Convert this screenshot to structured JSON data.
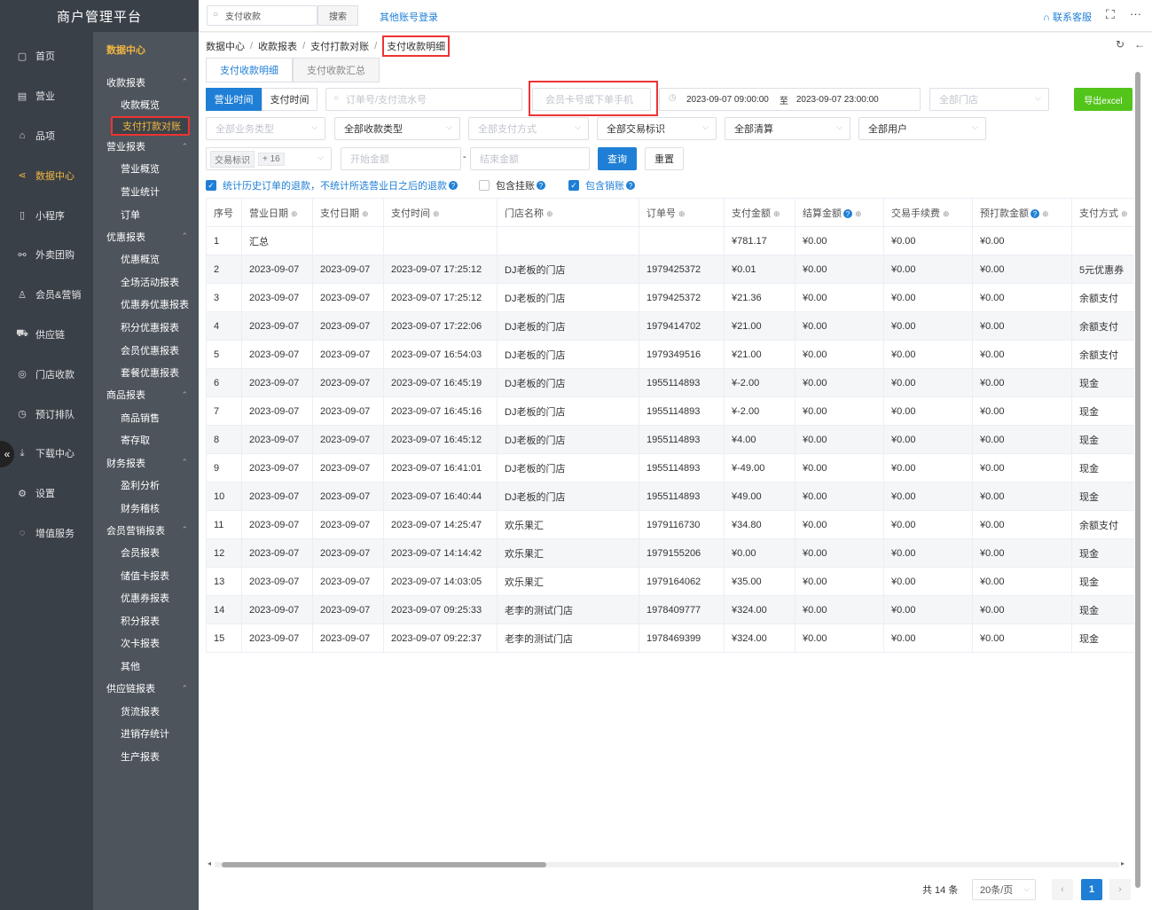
{
  "app": {
    "brand": "商户管理平台"
  },
  "nav": [
    {
      "icon": "home-icon",
      "glyph": "▢",
      "label": "首页"
    },
    {
      "icon": "business-icon",
      "glyph": "▤",
      "label": "营业"
    },
    {
      "icon": "product-icon",
      "glyph": "⌂",
      "label": "品项"
    },
    {
      "icon": "data-center-icon",
      "glyph": "⋖",
      "label": "数据中心",
      "active": true
    },
    {
      "icon": "mini-program-icon",
      "glyph": "▯",
      "label": "小程序"
    },
    {
      "icon": "group-buy-icon",
      "glyph": "⚯",
      "label": "外卖团购"
    },
    {
      "icon": "member-icon",
      "glyph": "♙",
      "label": "会员&营销"
    },
    {
      "icon": "supply-chain-icon",
      "glyph": "⛟",
      "label": "供应链"
    },
    {
      "icon": "store-cashier-icon",
      "glyph": "◎",
      "label": "门店收款"
    },
    {
      "icon": "reservation-icon",
      "glyph": "◷",
      "label": "预订排队"
    },
    {
      "icon": "download-icon",
      "glyph": "⤓",
      "label": "下载中心"
    },
    {
      "icon": "settings-icon",
      "glyph": "⚙",
      "label": "设置"
    },
    {
      "icon": "value-added-icon",
      "glyph": "◌",
      "label": "增值服务"
    }
  ],
  "section_title": "数据中心",
  "groups": [
    {
      "title": "收款报表",
      "items": [
        "收款概览",
        "支付打款对账"
      ]
    },
    {
      "title": "营业报表",
      "items": [
        "营业概览",
        "营业统计",
        "订单"
      ]
    },
    {
      "title": "优惠报表",
      "items": [
        "优惠概览",
        "全场活动报表",
        "优惠券优惠报表",
        "积分优惠报表",
        "会员优惠报表",
        "套餐优惠报表"
      ]
    },
    {
      "title": "商品报表",
      "items": [
        "商品销售",
        "寄存取"
      ]
    },
    {
      "title": "财务报表",
      "items": [
        "盈利分析",
        "财务稽核"
      ]
    },
    {
      "title": "会员营销报表",
      "items": [
        "会员报表",
        "储值卡报表",
        "优惠券报表",
        "积分报表",
        "次卡报表",
        "其他"
      ]
    },
    {
      "title": "供应链报表",
      "items": [
        "货流报表",
        "进销存统计",
        "生产报表"
      ]
    }
  ],
  "selected_item": "支付打款对账",
  "topbar": {
    "search_value": "支付收款",
    "search_button": "搜索",
    "other_login": "其他账号登录",
    "contact": "联系客服"
  },
  "breadcrumb": [
    "数据中心",
    "收款报表",
    "支付打款对账",
    "支付收款明细"
  ],
  "tabs": [
    "支付收款明细",
    "支付收款汇总"
  ],
  "time_mode": [
    "营业时间",
    "支付时间"
  ],
  "filters": {
    "order_placeholder": "订单号/支付流水号",
    "member_placeholder": "会员卡号或下单手机",
    "date_from": "2023-09-07 09:00:00",
    "date_sep": "至",
    "date_to": "2023-09-07 23:00:00",
    "store": "全部门店",
    "export": "导出excel",
    "biz_type": "全部业务类型",
    "receipt_type": "全部收款类型",
    "pay_method": "全部支付方式",
    "trade_flag": "全部交易标识",
    "clearing": "全部清算",
    "users": "全部用户",
    "tag": "交易标识",
    "tag_more": "+ 16",
    "amount_min": "开始金额",
    "amount_dash": "-",
    "amount_max": "结束金额",
    "query": "查询",
    "reset": "重置"
  },
  "checks": [
    {
      "label": "统计历史订单的退款，不统计所选营业日之后的退款",
      "checked": true,
      "highlight": true
    },
    {
      "label": "包含挂账",
      "checked": false,
      "highlight": false
    },
    {
      "label": "包含销账",
      "checked": true,
      "highlight": true
    }
  ],
  "table": {
    "headers": [
      "序号",
      "营业日期",
      "支付日期",
      "支付时间",
      "门店名称",
      "订单号",
      "支付金额",
      "结算金额",
      "交易手续费",
      "预打款金额",
      "支付方式"
    ],
    "rows": [
      [
        "1",
        "汇总",
        "",
        "",
        "",
        "",
        "¥781.17",
        "¥0.00",
        "¥0.00",
        "¥0.00",
        ""
      ],
      [
        "2",
        "2023-09-07",
        "2023-09-07",
        "2023-09-07 17:25:12",
        "DJ老板的门店",
        "1979425372",
        "¥0.01",
        "¥0.00",
        "¥0.00",
        "¥0.00",
        "5元优惠券"
      ],
      [
        "3",
        "2023-09-07",
        "2023-09-07",
        "2023-09-07 17:25:12",
        "DJ老板的门店",
        "1979425372",
        "¥21.36",
        "¥0.00",
        "¥0.00",
        "¥0.00",
        "余额支付"
      ],
      [
        "4",
        "2023-09-07",
        "2023-09-07",
        "2023-09-07 17:22:06",
        "DJ老板的门店",
        "1979414702",
        "¥21.00",
        "¥0.00",
        "¥0.00",
        "¥0.00",
        "余额支付"
      ],
      [
        "5",
        "2023-09-07",
        "2023-09-07",
        "2023-09-07 16:54:03",
        "DJ老板的门店",
        "1979349516",
        "¥21.00",
        "¥0.00",
        "¥0.00",
        "¥0.00",
        "余额支付"
      ],
      [
        "6",
        "2023-09-07",
        "2023-09-07",
        "2023-09-07 16:45:19",
        "DJ老板的门店",
        "1955114893",
        "¥-2.00",
        "¥0.00",
        "¥0.00",
        "¥0.00",
        "现金"
      ],
      [
        "7",
        "2023-09-07",
        "2023-09-07",
        "2023-09-07 16:45:16",
        "DJ老板的门店",
        "1955114893",
        "¥-2.00",
        "¥0.00",
        "¥0.00",
        "¥0.00",
        "现金"
      ],
      [
        "8",
        "2023-09-07",
        "2023-09-07",
        "2023-09-07 16:45:12",
        "DJ老板的门店",
        "1955114893",
        "¥4.00",
        "¥0.00",
        "¥0.00",
        "¥0.00",
        "现金"
      ],
      [
        "9",
        "2023-09-07",
        "2023-09-07",
        "2023-09-07 16:41:01",
        "DJ老板的门店",
        "1955114893",
        "¥-49.00",
        "¥0.00",
        "¥0.00",
        "¥0.00",
        "现金"
      ],
      [
        "10",
        "2023-09-07",
        "2023-09-07",
        "2023-09-07 16:40:44",
        "DJ老板的门店",
        "1955114893",
        "¥49.00",
        "¥0.00",
        "¥0.00",
        "¥0.00",
        "现金"
      ],
      [
        "11",
        "2023-09-07",
        "2023-09-07",
        "2023-09-07 14:25:47",
        "欢乐果汇",
        "1979116730",
        "¥34.80",
        "¥0.00",
        "¥0.00",
        "¥0.00",
        "余额支付"
      ],
      [
        "12",
        "2023-09-07",
        "2023-09-07",
        "2023-09-07 14:14:42",
        "欢乐果汇",
        "1979155206",
        "¥0.00",
        "¥0.00",
        "¥0.00",
        "¥0.00",
        "现金"
      ],
      [
        "13",
        "2023-09-07",
        "2023-09-07",
        "2023-09-07 14:03:05",
        "欢乐果汇",
        "1979164062",
        "¥35.00",
        "¥0.00",
        "¥0.00",
        "¥0.00",
        "现金"
      ],
      [
        "14",
        "2023-09-07",
        "2023-09-07",
        "2023-09-07 09:25:33",
        "老李的测试门店",
        "1978409777",
        "¥324.00",
        "¥0.00",
        "¥0.00",
        "¥0.00",
        "现金"
      ],
      [
        "15",
        "2023-09-07",
        "2023-09-07",
        "2023-09-07 09:22:37",
        "老李的测试门店",
        "1978469399",
        "¥324.00",
        "¥0.00",
        "¥0.00",
        "¥0.00",
        "现金"
      ]
    ]
  },
  "pager": {
    "total": "共 14 条",
    "page_size": "20条/页",
    "current": "1"
  }
}
